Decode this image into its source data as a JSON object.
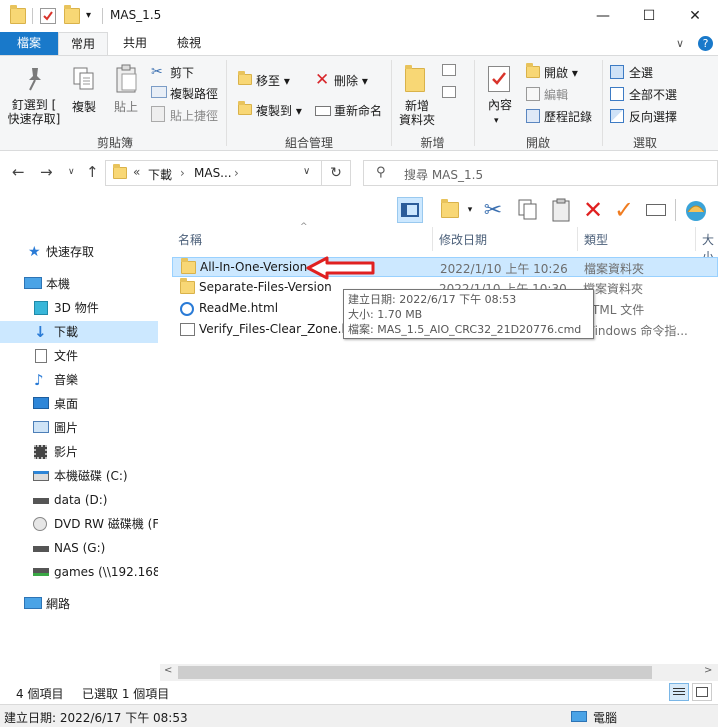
{
  "window": {
    "title": "MAS_1.5",
    "minimize_glyph": "—",
    "maximize_glyph": "☐",
    "close_glyph": "✕"
  },
  "tabs": [
    "檔案",
    "常用",
    "共用",
    "檢視"
  ],
  "ribbon": {
    "clipboard": {
      "pin_label": "釘選到 [\n快速存取]",
      "copy_label": "複製",
      "paste_label": "貼上",
      "cut": "剪下",
      "copy_path": "複製路徑",
      "paste_shortcut": "貼上捷徑",
      "group_label": "剪貼簿"
    },
    "organize": {
      "move_to": "移至",
      "copy_to": "複製到",
      "delete": "刪除",
      "rename": "重新命名",
      "group_label": "組合管理"
    },
    "new": {
      "new_folder": "新增\n資料夾",
      "group_label": "新增"
    },
    "open": {
      "properties": "內容",
      "open": "開啟",
      "edit": "編輯",
      "history": "歷程記錄",
      "group_label": "開啟"
    },
    "select": {
      "select_all": "全選",
      "select_none": "全部不選",
      "invert": "反向選擇",
      "group_label": "選取"
    }
  },
  "address": {
    "overflow": "«",
    "crumbs": [
      "下載",
      "MAS..."
    ],
    "chevron": "›",
    "search_placeholder": "搜尋 MAS_1.5"
  },
  "nav": {
    "items": [
      {
        "label": "快速存取",
        "icon": "star-icon"
      },
      {
        "label": "本機",
        "icon": "computer-icon"
      },
      {
        "label": "3D 物件",
        "icon": "cube-icon"
      },
      {
        "label": "下載",
        "icon": "download-icon"
      },
      {
        "label": "文件",
        "icon": "document-icon"
      },
      {
        "label": "音樂",
        "icon": "music-icon"
      },
      {
        "label": "桌面",
        "icon": "desktop-icon"
      },
      {
        "label": "圖片",
        "icon": "picture-icon"
      },
      {
        "label": "影片",
        "icon": "video-icon"
      },
      {
        "label": "本機磁碟 (C:)",
        "icon": "drive-icon"
      },
      {
        "label": "data (D:)",
        "icon": "drive-icon"
      },
      {
        "label": "DVD RW 磁碟機 (F:",
        "icon": "dvd-icon"
      },
      {
        "label": "NAS (G:)",
        "icon": "drive-icon"
      },
      {
        "label": "games (\\\\192.168.",
        "icon": "network-drive-icon"
      },
      {
        "label": "網路",
        "icon": "network-icon"
      }
    ]
  },
  "columns": [
    "名稱",
    "修改日期",
    "類型",
    "大小"
  ],
  "files": [
    {
      "name": "All-In-One-Version",
      "date": "2022/1/10 上午 10:26",
      "type": "檔案資料夾"
    },
    {
      "name": "Separate-Files-Version",
      "date": "2022/1/10 上午 10:30",
      "type": "檔案資料夾"
    },
    {
      "name": "ReadMe.html",
      "date": "",
      "type": "HTML 文件"
    },
    {
      "name": "Verify_Files-Clear_Zone.ld",
      "date": "",
      "type": "Windows 命令指..."
    }
  ],
  "tooltip": {
    "line1": "建立日期: 2022/6/17 下午 08:53",
    "line2": "大小: 1.70 MB",
    "line3": "檔案: MAS_1.5_AIO_CRC32_21D20776.cmd"
  },
  "status": {
    "count": "4 個項目",
    "selected": "已選取 1 個項目",
    "created": "建立日期: 2022/6/17 下午 08:53",
    "location": "電腦"
  },
  "colors": {
    "accent": "#1979ca",
    "selection": "#cce8ff",
    "arrow": "#e02020"
  }
}
